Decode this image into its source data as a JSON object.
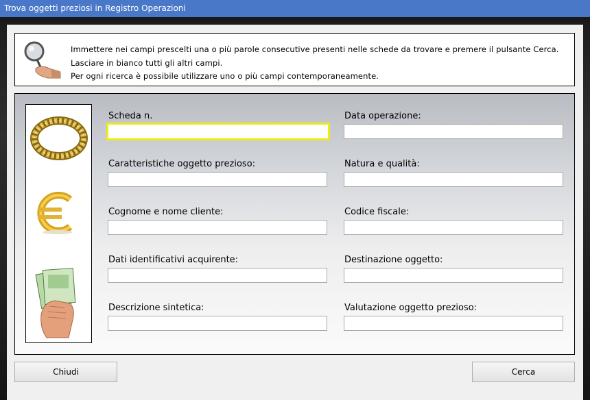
{
  "window": {
    "title": "Trova oggetti preziosi in Registro Operazioni"
  },
  "info": {
    "icon": "magnifier-hand-icon",
    "lines": [
      "Immettere nei campi prescelti una o più parole consecutive presenti nelle schede da trovare e premere il pulsante Cerca.",
      "Lasciare in bianco tutti gli altri campi.",
      "Per ogni ricerca è possibile utilizzare uno o più campi contemporaneamente."
    ]
  },
  "images": [
    "gold-ring-icon",
    "euro-sign-icon",
    "banknotes-hand-icon"
  ],
  "fields": {
    "scheda": {
      "label": "Scheda n.",
      "value": ""
    },
    "data_operazione": {
      "label": "Data operazione:",
      "value": ""
    },
    "caratteristiche": {
      "label": "Caratteristiche oggetto prezioso:",
      "value": ""
    },
    "natura": {
      "label": "Natura e qualità:",
      "value": ""
    },
    "cliente": {
      "label": "Cognome e nome cliente:",
      "value": ""
    },
    "codice_fiscale": {
      "label": "Codice fiscale:",
      "value": ""
    },
    "acquirente": {
      "label": "Dati identificativi acquirente:",
      "value": ""
    },
    "destinazione": {
      "label": "Destinazione oggetto:",
      "value": ""
    },
    "descrizione": {
      "label": "Descrizione sintetica:",
      "value": ""
    },
    "valutazione": {
      "label": "Valutazione oggetto prezioso:",
      "value": ""
    }
  },
  "buttons": {
    "close": "Chiudi",
    "search": "Cerca"
  }
}
